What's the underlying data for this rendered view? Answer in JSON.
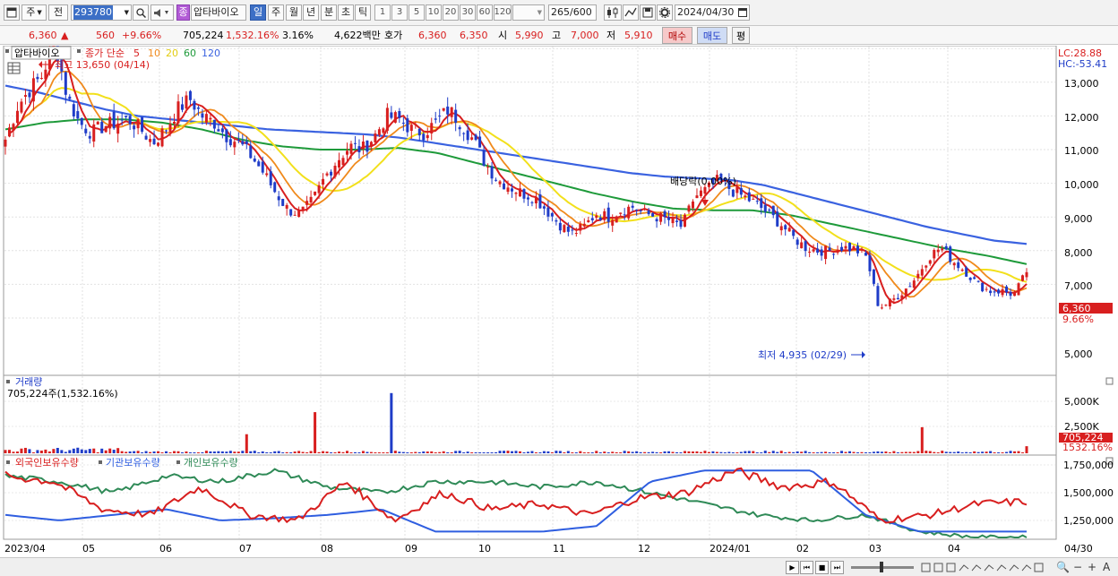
{
  "toolbar": {
    "period_mode": "주",
    "prev_label": "전",
    "stock_code": "293780",
    "stock_badge": "종",
    "stock_name": "압타바이오",
    "timeframes": [
      "일",
      "주",
      "월",
      "년",
      "분",
      "초",
      "틱"
    ],
    "active_timeframe": "일",
    "intervals": [
      "1",
      "3",
      "5",
      "10",
      "20",
      "30",
      "60",
      "120"
    ],
    "bar_count": "265",
    "bar_total": "/600",
    "date": "2024/04/30"
  },
  "info": {
    "price": "6,360",
    "up_arrow": "▲",
    "change": "560",
    "change_pct": "+9.66%",
    "volume": "705,224",
    "volume_pct": "1,532.16%",
    "turnover": "3.16%",
    "amount": "4,622백만",
    "quote_label": "호가",
    "ask": "6,360",
    "bid": "6,350",
    "open_label": "시",
    "open": "5,990",
    "high_label": "고",
    "high": "7,000",
    "low_label": "저",
    "low": "5,910",
    "buy_label": "매수",
    "sell_label": "매도",
    "avg_label": "평"
  },
  "price_pane": {
    "stock_tag": "압타바이오",
    "ma_title": "종가 단순",
    "ma_periods": [
      "5",
      "10",
      "20",
      "60",
      "120"
    ],
    "ma_colors": [
      "#d81f1f",
      "#f08a1c",
      "#f2e01c",
      "#1e9a3a",
      "#3a62e0"
    ],
    "lc": "LC:28.88",
    "hc": "HC:-53.41",
    "high_note": "최고 13,650 (04/14)",
    "low_note": "최저 4,935 (02/29)",
    "dividend_note": "배당락(0.00%)",
    "current_price": "6,360",
    "current_pct": "9.66%",
    "y_ticks": [
      "13,000",
      "12,000",
      "11,000",
      "10,000",
      "9,000",
      "8,000",
      "7,000",
      "5,000"
    ]
  },
  "volume_pane": {
    "title": "거래량",
    "value": "705,224주(1,532.16%)",
    "y_ticks": [
      "5,000K",
      "2,500K"
    ],
    "current_value": "705,224",
    "current_pct": "1532.16%"
  },
  "holdings_pane": {
    "legend": [
      "외국인보유수량",
      "기관보유수량",
      "개인보유수량"
    ],
    "colors": [
      "#d81f1f",
      "#2f5ee0",
      "#2f8a57"
    ],
    "y_ticks": [
      "1,750,000",
      "1,500,000",
      "1,250,000"
    ]
  },
  "x_axis": {
    "labels": [
      "2023/04",
      "05",
      "06",
      "07",
      "08",
      "09",
      "10",
      "11",
      "12",
      "2024/01",
      "02",
      "03",
      "04"
    ],
    "right_label": "04/30"
  },
  "chart_data": {
    "type": "candlestick",
    "date_range": [
      "2023/04",
      "2024/04/30"
    ],
    "price_range": [
      4935,
      13650
    ],
    "close_path": [
      10300,
      11300,
      11800,
      12200,
      13300,
      11600,
      10800,
      10500,
      10700,
      10800,
      10900,
      10600,
      10200,
      10600,
      11200,
      11500,
      11000,
      10800,
      10400,
      10200,
      9800,
      9300,
      8700,
      8200,
      8100,
      8500,
      9200,
      9700,
      10100,
      10000,
      10400,
      11000,
      10900,
      10600,
      10500,
      10800,
      11200,
      10800,
      10300,
      9600,
      9100,
      8900,
      8700,
      8600,
      8200,
      7800,
      7500,
      7700,
      8100,
      8000,
      8200,
      8300,
      8100,
      8000,
      7900,
      7700,
      8600,
      8800,
      9100,
      8800,
      8600,
      8400,
      8100,
      7800,
      7400,
      7100,
      7000,
      7000,
      7100,
      7050,
      6800,
      5300,
      5500,
      5800,
      6200,
      6800,
      7100,
      6700,
      6400,
      6000,
      5800,
      5800,
      5700,
      6360
    ],
    "ma120_path": [
      11900,
      11700,
      11450,
      11200,
      11000,
      10900,
      10800,
      10700,
      10600,
      10550,
      10500,
      10450,
      10350,
      10200,
      10050,
      9900,
      9750,
      9600,
      9450,
      9300,
      9200,
      9150,
      9100,
      8950,
      8700,
      8450,
      8200,
      7950,
      7700,
      7500,
      7300,
      7200
    ],
    "ma60_path": [
      10600,
      10800,
      10900,
      10900,
      10800,
      10600,
      10300,
      10100,
      10000,
      10000,
      10050,
      9900,
      9600,
      9300,
      9000,
      8700,
      8450,
      8250,
      8200,
      8200,
      8050,
      7800,
      7550,
      7300,
      7050,
      6850,
      6600
    ],
    "volume_spikes": [
      {
        "date": "07",
        "value": 1900
      },
      {
        "date": "08",
        "value": 4100
      },
      {
        "date": "08",
        "value": 6000
      },
      {
        "date": "03",
        "value": 2600
      },
      {
        "date": "04/30",
        "value": 705
      }
    ]
  },
  "bottom": {
    "nav": [
      "▶",
      "⏮",
      "■",
      "⏭"
    ],
    "tools": [
      "🔍",
      "−",
      "+",
      "A"
    ]
  }
}
